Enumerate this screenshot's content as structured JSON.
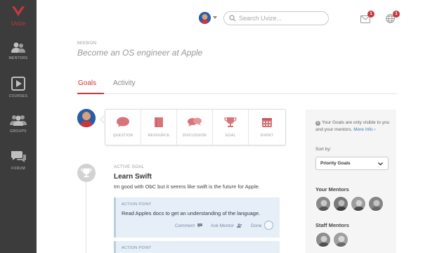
{
  "brand": {
    "name": "Uvize",
    "accent": "#c8383d"
  },
  "sidebar": {
    "items": [
      {
        "label": "MENTORS",
        "icon": "mentors-icon"
      },
      {
        "label": "COURSES",
        "icon": "play-icon"
      },
      {
        "label": "GROUPS",
        "icon": "groups-icon"
      },
      {
        "label": "FORUM",
        "icon": "forum-icon"
      }
    ]
  },
  "header": {
    "search_placeholder": "Search Uvize...",
    "messages_badge": "1",
    "notifications_badge": "1"
  },
  "mission": {
    "label": "MISSION",
    "title": "Become an OS engineer at Apple"
  },
  "tabs": [
    {
      "label": "Goals",
      "active": true
    },
    {
      "label": "Activity",
      "active": false
    }
  ],
  "composer": {
    "buttons": [
      {
        "label": "QUESTION",
        "icon": "speech-bubble-icon"
      },
      {
        "label": "RESOURCE",
        "icon": "book-icon"
      },
      {
        "label": "DISCUSSION",
        "icon": "discussion-icon"
      },
      {
        "label": "GOAL",
        "icon": "trophy-icon"
      },
      {
        "label": "EVENT",
        "icon": "calendar-icon"
      }
    ]
  },
  "goal": {
    "status": "ACTIVE GOAL",
    "title": "Learn Swift",
    "description": "Im good with ObC but it seems like swift is the future for Apple.",
    "action_points": [
      {
        "label": "ACTION POINT",
        "text": "Read Apples docs to get an understanding of the language.",
        "comment": "Comment",
        "ask_mentor": "Ask Mentor",
        "done": "Done"
      },
      {
        "label": "ACTION POINT"
      }
    ]
  },
  "right_panel": {
    "info_text": "Your Goals are only visible to you and your mentors.",
    "more_info": "More Info ›",
    "sort_label": "Sort by:",
    "sort_value": "Priority Goals",
    "your_mentors_title": "Your Mentors",
    "staff_mentors_title": "Staff Mentors"
  }
}
